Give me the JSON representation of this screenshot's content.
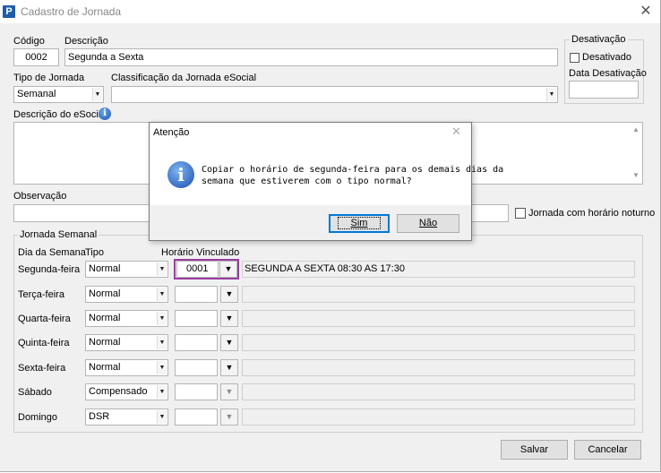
{
  "window": {
    "title": "Cadastro de Jornada",
    "close_glyph": "✕"
  },
  "header": {
    "codigo_label": "Código",
    "codigo_value": "0002",
    "descricao_label": "Descrição",
    "descricao_value": "Segunda a Sexta",
    "tipo_label": "Tipo de Jornada",
    "tipo_value": "Semanal",
    "classificacao_label": "Classificação da Jornada eSocial",
    "classificacao_value": "",
    "desc_esocial_label": "Descrição do eSocial",
    "observacao_label": "Observação",
    "observacao_value": "",
    "noturno_label": "Jornada com horário noturno"
  },
  "desativacao": {
    "legend": "Desativação",
    "checkbox_label": "Desativado",
    "data_label": "Data Desativação",
    "data_value": ""
  },
  "jornada_semanal": {
    "legend": "Jornada Semanal",
    "col_dia": "Dia da Semana",
    "col_tipo": "Tipo",
    "col_horario": "Horário Vinculado",
    "rows": [
      {
        "day": "Segunda-feira",
        "tipo": "Normal",
        "horario": "0001",
        "descricao": "SEGUNDA A SEXTA 08:30 AS 17:30"
      },
      {
        "day": "Terça-feira",
        "tipo": "Normal",
        "horario": "",
        "descricao": ""
      },
      {
        "day": "Quarta-feira",
        "tipo": "Normal",
        "horario": "",
        "descricao": ""
      },
      {
        "day": "Quinta-feira",
        "tipo": "Normal",
        "horario": "",
        "descricao": ""
      },
      {
        "day": "Sexta-feira",
        "tipo": "Normal",
        "horario": "",
        "descricao": ""
      },
      {
        "day": "Sábado",
        "tipo": "Compensado",
        "horario": "",
        "descricao": ""
      },
      {
        "day": "Domingo",
        "tipo": "DSR",
        "horario": "",
        "descricao": ""
      }
    ]
  },
  "footer": {
    "save_label": "Salvar",
    "cancel_label": "Cancelar"
  },
  "dialog": {
    "title": "Atenção",
    "message_line1": "Copiar o horário de segunda-feira para os demais dias da",
    "message_line2": "semana que estiverem com o tipo normal?",
    "yes_label": "Sim",
    "no_label": "Não"
  },
  "colors": {
    "accent": "#1e5ea8",
    "highlight_border": "#9b3da0"
  }
}
